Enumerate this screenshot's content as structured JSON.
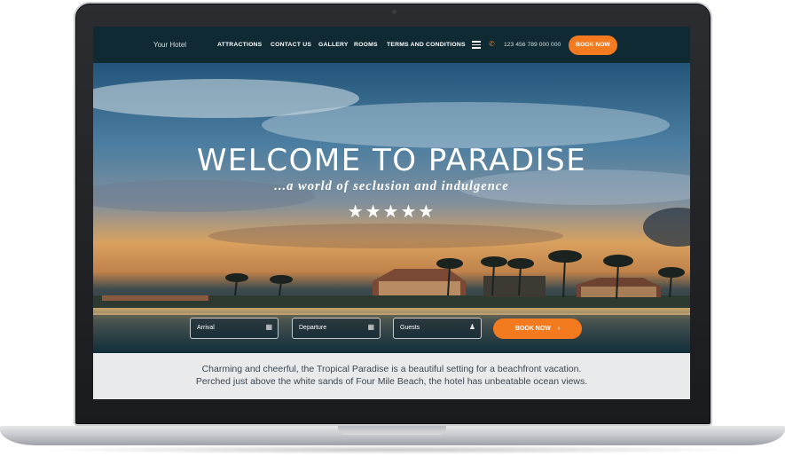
{
  "navbar": {
    "brand": "Your Hotel",
    "items": [
      "ATTRACTIONS",
      "CONTACT US",
      "GALLERY",
      "ROOMS",
      "TERMS AND CONDITIONS"
    ],
    "phone": "123 456 789 000 000",
    "book_label": "BOOK NOW"
  },
  "hero": {
    "title": "WELCOME TO PARADISE",
    "subtitle": "...a world of seclusion and indulgence",
    "stars": "★★★★★"
  },
  "booking": {
    "arrival_label": "Arrival",
    "departure_label": "Departure",
    "guests_label": "Guests",
    "book_label": "BOOK NOW",
    "book_chevron": "›"
  },
  "intro": {
    "line1": "Charming and cheerful, the Tropical Paradise is a beautiful setting for a beachfront vacation.",
    "line2": "Perched just above the white sands of Four Mile Beach, the hotel has unbeatable ocean views."
  },
  "colors": {
    "accent": "#f47a20",
    "navbar": "#0f2a33",
    "intro_bg": "#e9eaec"
  },
  "icons": {
    "menu": "hamburger-icon",
    "phone": "phone-icon",
    "calendar": "calendar-icon",
    "guest": "user-icon",
    "chevron": "chevron-right-icon"
  }
}
